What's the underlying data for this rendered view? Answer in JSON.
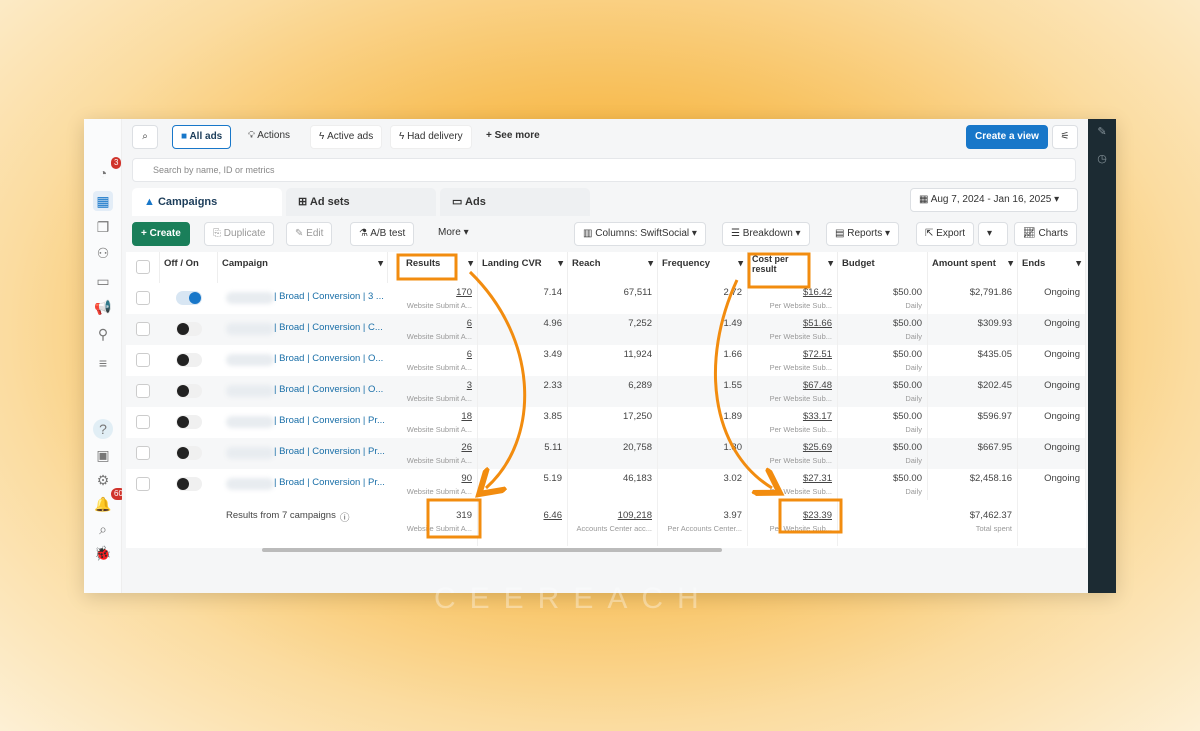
{
  "toolbar": {
    "all_ads": "All ads",
    "actions": "Actions",
    "active_ads": "Active ads",
    "had_delivery": "Had delivery",
    "see_more": "See more",
    "create_view": "Create a view"
  },
  "search": {
    "placeholder": "Search by name, ID or metrics"
  },
  "tabs": [
    "Campaigns",
    "Ad sets",
    "Ads"
  ],
  "date_range": "Aug 7, 2024 - Jan 16, 2025",
  "actions": {
    "create": "Create",
    "duplicate": "Duplicate",
    "edit": "Edit",
    "ab_test": "A/B test",
    "more": "More",
    "columns": "Columns: SwiftSocial",
    "breakdown": "Breakdown",
    "reports": "Reports",
    "export": "Export",
    "charts": "Charts"
  },
  "sidebar": {
    "notifications_badge": "3",
    "alerts_badge": "60"
  },
  "columns": [
    "Off / On",
    "Campaign",
    "Results",
    "Landing CVR",
    "Reach",
    "Frequency",
    "Cost per result",
    "Budget",
    "Amount spent",
    "Ends"
  ],
  "rows": [
    {
      "on": true,
      "campaign": "| Broad | Conversion | 3 ...",
      "results": "170",
      "results_sub": "Website Submit A...",
      "cvr": "7.14",
      "reach": "67,511",
      "frequency": "2.72",
      "cpr": "$16.42",
      "cpr_sub": "Per Website Sub...",
      "budget": "$50.00",
      "budget_sub": "Daily",
      "spent": "$2,791.86",
      "ends": "Ongoing"
    },
    {
      "on": false,
      "campaign": "| Broad | Conversion | C...",
      "results": "6",
      "results_sub": "Website Submit A...",
      "cvr": "4.96",
      "reach": "7,252",
      "frequency": "1.49",
      "cpr": "$51.66",
      "cpr_sub": "Per Website Sub...",
      "budget": "$50.00",
      "budget_sub": "Daily",
      "spent": "$309.93",
      "ends": "Ongoing"
    },
    {
      "on": false,
      "campaign": "| Broad | Conversion | O...",
      "results": "6",
      "results_sub": "Website Submit A...",
      "cvr": "3.49",
      "reach": "11,924",
      "frequency": "1.66",
      "cpr": "$72.51",
      "cpr_sub": "Per Website Sub...",
      "budget": "$50.00",
      "budget_sub": "Daily",
      "spent": "$435.05",
      "ends": "Ongoing"
    },
    {
      "on": false,
      "campaign": "| Broad | Conversion | O...",
      "results": "3",
      "results_sub": "Website Submit A...",
      "cvr": "2.33",
      "reach": "6,289",
      "frequency": "1.55",
      "cpr": "$67.48",
      "cpr_sub": "Per Website Sub...",
      "budget": "$50.00",
      "budget_sub": "Daily",
      "spent": "$202.45",
      "ends": "Ongoing"
    },
    {
      "on": false,
      "campaign": "| Broad | Conversion | Pr...",
      "results": "18",
      "results_sub": "Website Submit A...",
      "cvr": "3.85",
      "reach": "17,250",
      "frequency": "1.89",
      "cpr": "$33.17",
      "cpr_sub": "Per Website Sub...",
      "budget": "$50.00",
      "budget_sub": "Daily",
      "spent": "$596.97",
      "ends": "Ongoing"
    },
    {
      "on": false,
      "campaign": "| Broad | Conversion | Pr...",
      "results": "26",
      "results_sub": "Website Submit A...",
      "cvr": "5.11",
      "reach": "20,758",
      "frequency": "1.80",
      "cpr": "$25.69",
      "cpr_sub": "Per Website Sub...",
      "budget": "$50.00",
      "budget_sub": "Daily",
      "spent": "$667.95",
      "ends": "Ongoing"
    },
    {
      "on": false,
      "campaign": "| Broad | Conversion | Pr...",
      "results": "90",
      "results_sub": "Website Submit A...",
      "cvr": "5.19",
      "reach": "46,183",
      "frequency": "3.02",
      "cpr": "$27.31",
      "cpr_sub": "Per Website Sub...",
      "budget": "$50.00",
      "budget_sub": "Daily",
      "spent": "$2,458.16",
      "ends": "Ongoing"
    }
  ],
  "totals": {
    "label": "Results from 7 campaigns",
    "results": "319",
    "results_sub": "Website Submit A...",
    "cvr": "6.46",
    "reach": "109,218",
    "reach_sub": "Accounts Center acc...",
    "frequency": "3.97",
    "frequency_sub": "Per Accounts Center...",
    "cpr": "$23.39",
    "cpr_sub": "Per Website Sub...",
    "spent": "$7,462.37",
    "spent_sub": "Total spent"
  },
  "watermark": "CEEREACH",
  "colors": {
    "highlight": "#f28c0f",
    "primary": "#1877c9",
    "create": "#1a7f5a"
  }
}
